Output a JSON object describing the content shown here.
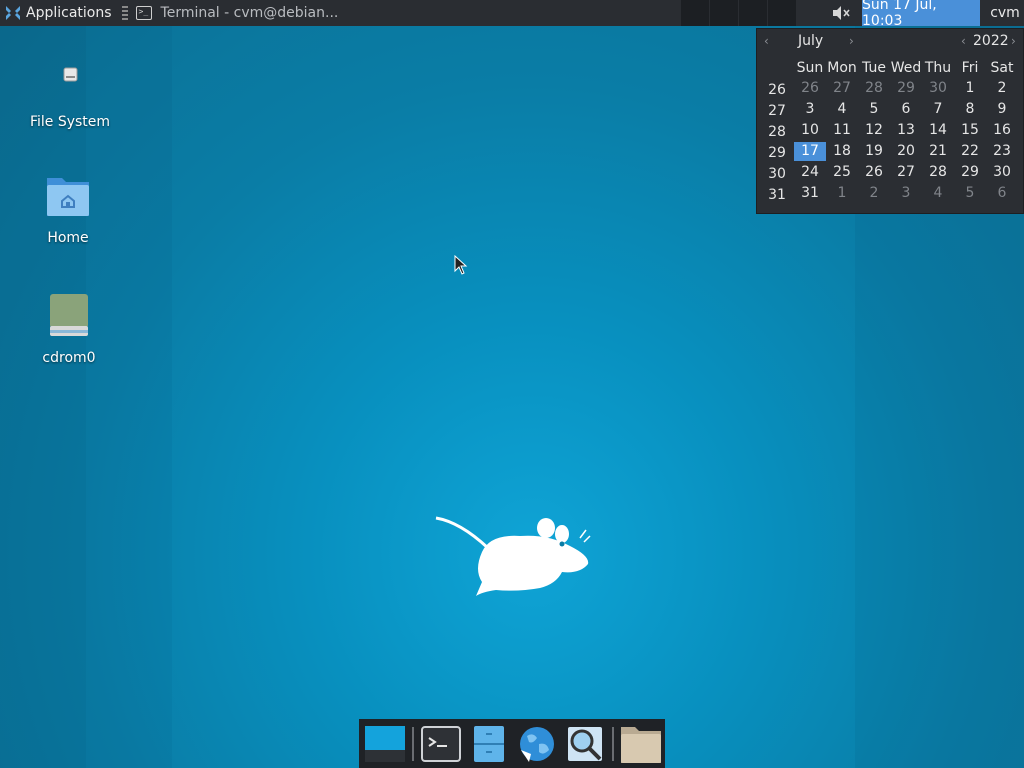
{
  "top_panel": {
    "applications_label": "Applications",
    "window_title": "Terminal - cvm@debian...",
    "clock": "Sun 17 Jul, 10:03",
    "user": "cvm",
    "icons": [
      "xfce-logo-icon",
      "terminal-icon",
      "volume-muted-icon"
    ]
  },
  "desktop": {
    "icons": [
      {
        "label": "File System",
        "icon": "drive-icon"
      },
      {
        "label": "Home",
        "icon": "home-folder-icon"
      },
      {
        "label": "cdrom0",
        "icon": "cdrom-icon"
      }
    ]
  },
  "calendar": {
    "month": "July",
    "year": "2022",
    "weekday_headers": [
      "Sun",
      "Mon",
      "Tue",
      "Wed",
      "Thu",
      "Fri",
      "Sat"
    ],
    "weeks": [
      {
        "week": "26",
        "days": [
          "26",
          "27",
          "28",
          "29",
          "30",
          "1",
          "2"
        ],
        "other": [
          true,
          true,
          true,
          true,
          true,
          false,
          false
        ]
      },
      {
        "week": "27",
        "days": [
          "3",
          "4",
          "5",
          "6",
          "7",
          "8",
          "9"
        ],
        "other": [
          false,
          false,
          false,
          false,
          false,
          false,
          false
        ]
      },
      {
        "week": "28",
        "days": [
          "10",
          "11",
          "12",
          "13",
          "14",
          "15",
          "16"
        ],
        "other": [
          false,
          false,
          false,
          false,
          false,
          false,
          false
        ]
      },
      {
        "week": "29",
        "days": [
          "17",
          "18",
          "19",
          "20",
          "21",
          "22",
          "23"
        ],
        "other": [
          false,
          false,
          false,
          false,
          false,
          false,
          false
        ]
      },
      {
        "week": "30",
        "days": [
          "24",
          "25",
          "26",
          "27",
          "28",
          "29",
          "30"
        ],
        "other": [
          false,
          false,
          false,
          false,
          false,
          false,
          false
        ]
      },
      {
        "week": "31",
        "days": [
          "31",
          "1",
          "2",
          "3",
          "4",
          "5",
          "6"
        ],
        "other": [
          false,
          true,
          true,
          true,
          true,
          true,
          true
        ]
      }
    ],
    "today": "17"
  },
  "dock": {
    "items": [
      "show-desktop-icon",
      "terminal-icon",
      "file-manager-icon",
      "web-browser-icon",
      "app-finder-icon",
      "folder-icon"
    ]
  },
  "colors": {
    "accent": "#4a90d9",
    "panel": "#2a2d32",
    "desktop": "#0a87b5"
  }
}
